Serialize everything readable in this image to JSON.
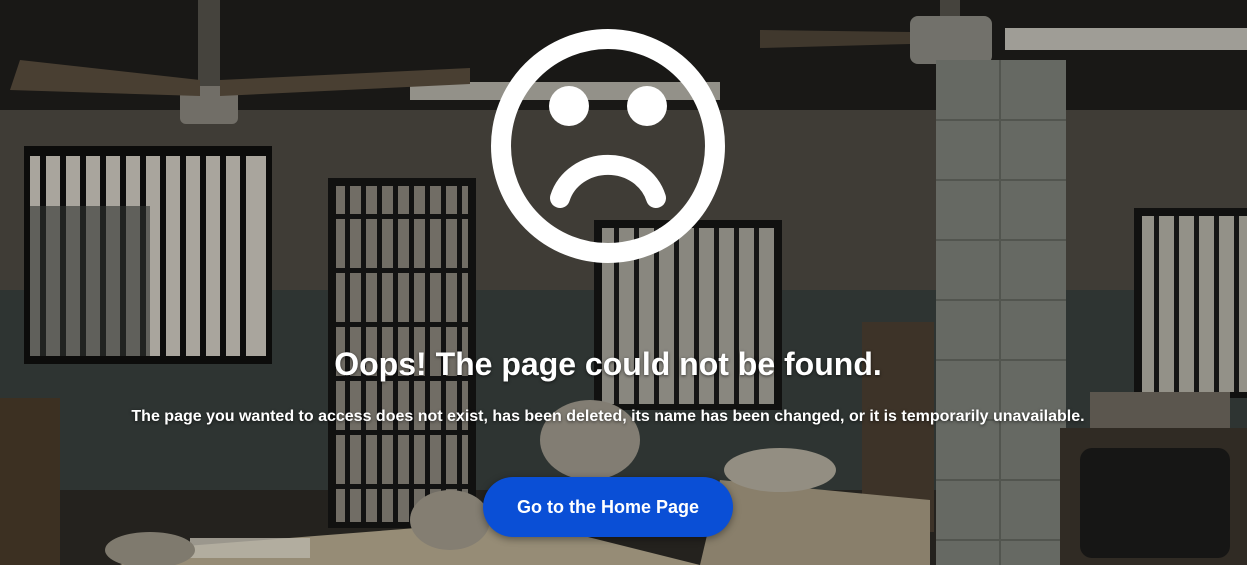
{
  "error": {
    "icon": "sad-face-icon",
    "title": "Oops! The page could not be found.",
    "message": "The page you wanted to access does not exist, has been deleted, its name has been changed, or it is temporarily unavailable."
  },
  "actions": {
    "home_label": "Go to the Home Page"
  },
  "colors": {
    "button_background": "#0a4fd6",
    "text": "#ffffff",
    "icon": "#ffffff"
  }
}
